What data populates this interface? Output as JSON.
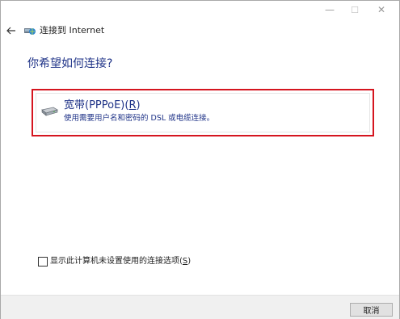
{
  "window": {
    "title": "连接到 Internet",
    "minimize_glyph": "—",
    "maximize_glyph": "☐",
    "close_glyph": "✕"
  },
  "heading": "你希望如何连接?",
  "option": {
    "title_prefix": "宽带(PPPoE)(",
    "title_key": "R",
    "title_suffix": ")",
    "description": "使用需要用户名和密码的 DSL 或电缆连接。",
    "icon": "broadband-modem-icon",
    "highlight_color": "#d5151f"
  },
  "checkbox": {
    "checked": false,
    "label_prefix": "显示此计算机未设置使用的连接选项(",
    "label_key": "S",
    "label_suffix": ")"
  },
  "footer": {
    "cancel_label": "取消"
  }
}
